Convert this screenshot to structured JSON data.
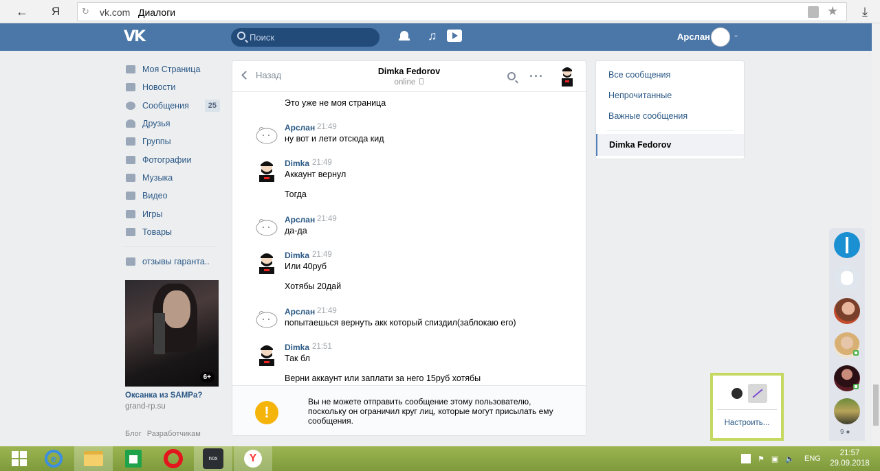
{
  "browser": {
    "back_icon": "back-arrow-icon",
    "logo": "Я",
    "domain": "vk.com",
    "page_title": "Диалоги"
  },
  "header": {
    "search_placeholder": "Поиск",
    "user_name": "Арслан"
  },
  "left_menu": {
    "items": [
      {
        "label": "Моя Страница",
        "icon": "home-icon"
      },
      {
        "label": "Новости",
        "icon": "news-icon"
      },
      {
        "label": "Сообщения",
        "icon": "messages-icon",
        "badge": "25"
      },
      {
        "label": "Друзья",
        "icon": "friends-icon"
      },
      {
        "label": "Группы",
        "icon": "groups-icon"
      },
      {
        "label": "Фотографии",
        "icon": "photos-icon"
      },
      {
        "label": "Музыка",
        "icon": "music-icon"
      },
      {
        "label": "Видео",
        "icon": "video-icon"
      },
      {
        "label": "Игры",
        "icon": "games-icon"
      },
      {
        "label": "Товары",
        "icon": "goods-icon"
      }
    ],
    "extra": "отзывы гаранта..",
    "ad": {
      "title": "Оксанка из SAMPа?",
      "subtitle": "grand-rp.su",
      "badge": "6+"
    },
    "footer": [
      "Блог",
      "Разработчикам"
    ]
  },
  "chat": {
    "back_label": "Назад",
    "peer_name": "Dimka Fedorov",
    "peer_status": "online",
    "messages": [
      {
        "author": "",
        "time": "",
        "lines": [
          "Это уже не моя страница"
        ]
      },
      {
        "author": "Арслан",
        "time": "21:49",
        "lines": [
          "ну вот и лети отсюда кид"
        ]
      },
      {
        "author": "Dimka",
        "time": "21:49",
        "lines": [
          "Аккаунт вернул",
          "Тогда"
        ]
      },
      {
        "author": "Арслан",
        "time": "21:49",
        "lines": [
          "да-да"
        ]
      },
      {
        "author": "Dimka",
        "time": "21:49",
        "lines": [
          "Или 40руб",
          "Хотябы 20дай"
        ]
      },
      {
        "author": "Арслан",
        "time": "21:49",
        "lines": [
          "попытаешься вернуть акк который спиздил(заблокаю его)"
        ]
      },
      {
        "author": "Dimka",
        "time": "21:51",
        "lines": [
          "Так бл",
          "Верни аккаунт или заплати за него 15руб хотябы"
        ]
      }
    ],
    "notice": "Вы не можете отправить сообщение этому пользователю, поскольку он ограничил круг лиц, которые могут присылать ему сообщения."
  },
  "right_menu": {
    "items": [
      "Все сообщения",
      "Непрочитанные",
      "Важные сообщения"
    ],
    "active": "Dimka Fedorov"
  },
  "sidebar": {
    "count": "9"
  },
  "popup": {
    "configure": "Настроить..."
  },
  "taskbar": {
    "lang": "ENG",
    "time": "21:57",
    "date": "29.09.2018"
  }
}
